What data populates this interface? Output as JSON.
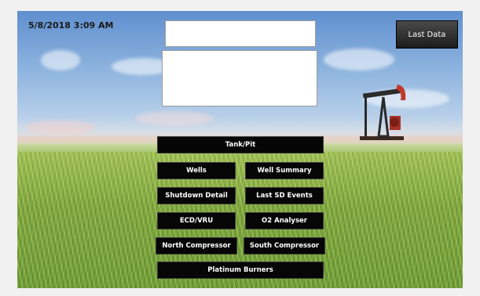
{
  "header": {
    "timestamp": "5/8/2018 3:09 AM",
    "last_data_label": "Last Data"
  },
  "menu": {
    "tank_pit": "Tank/Pit",
    "wells": "Wells",
    "well_summary": "Well Summary",
    "shutdown_detail": "Shutdown Detail",
    "last_sd_events": "Last SD Events",
    "ecd_vru": "ECD/VRU",
    "o2_analyser": "O2 Analyser",
    "north_compressor": "North Compressor",
    "south_compressor": "South Compressor",
    "platinum_burners": "Platinum Burners"
  },
  "colors": {
    "button_bg": "#060606",
    "button_text": "#ffffff",
    "page_bg": "#f1f1f1"
  }
}
